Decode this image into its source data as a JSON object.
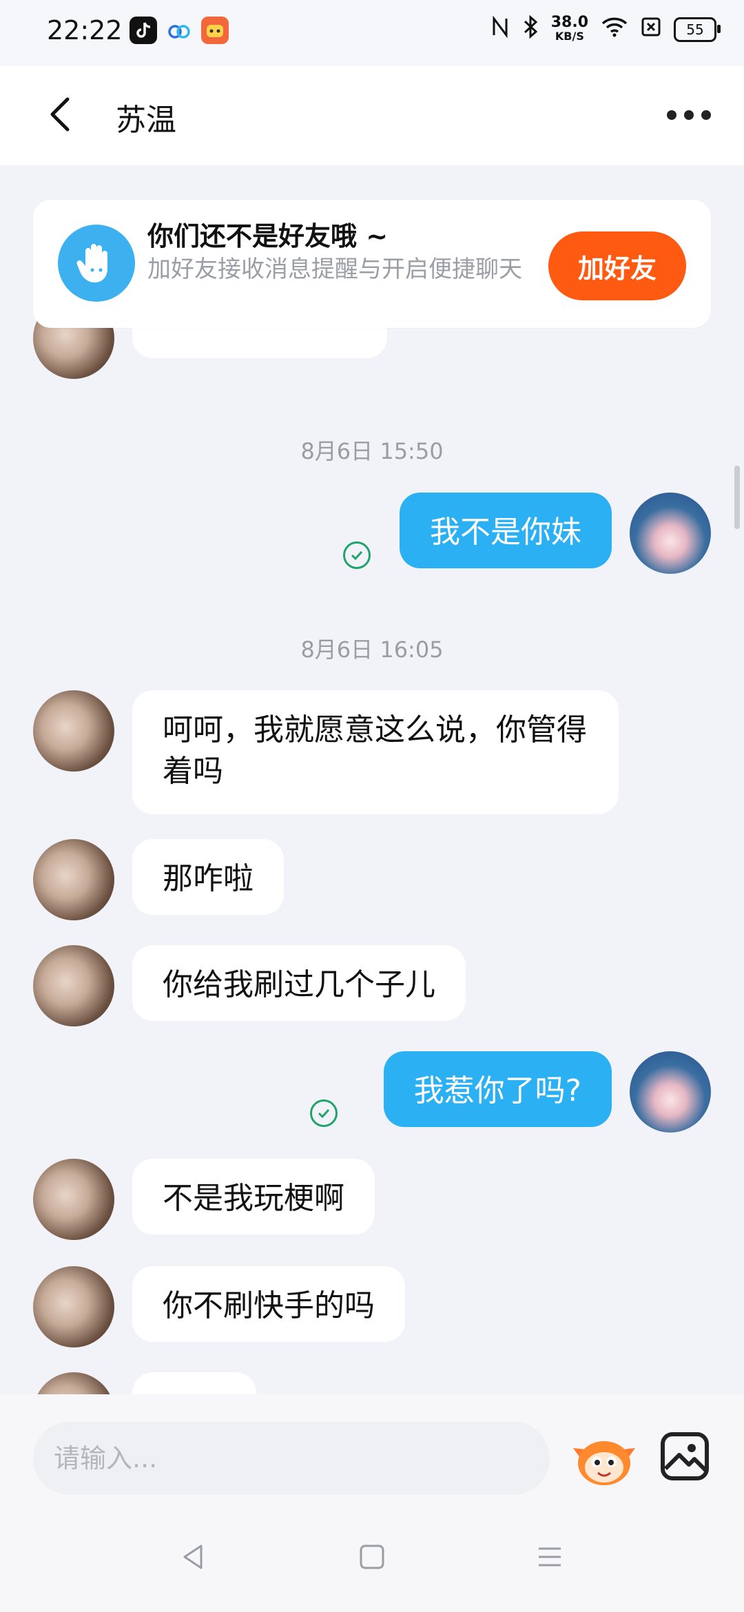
{
  "status_bar": {
    "time": "22:22",
    "net_speed_value": "38.0",
    "net_speed_unit": "KB/S",
    "battery": "55"
  },
  "header": {
    "title": "苏温"
  },
  "friend_banner": {
    "title": "你们还不是好友哦 ~",
    "subtitle": "加好友接收消息提醒与开启便捷聊天",
    "button": "加好友"
  },
  "messages": {
    "time1": "8月6日 15:50",
    "me1": "我不是你妹",
    "time2": "8月6日 16:05",
    "other1": "呵呵，我就愿意这么说，你管得着吗",
    "other2": "那咋啦",
    "other3": "你给我刷过几个子儿",
    "me2": "我惹你了吗?",
    "other4": "不是我玩梗啊",
    "other5": "你不刷快手的吗"
  },
  "input": {
    "placeholder": "请输入..."
  },
  "colors": {
    "accent_blue": "#2bb0f3",
    "add_friend_orange": "#ff5a12",
    "read_green": "#1fa36a"
  }
}
